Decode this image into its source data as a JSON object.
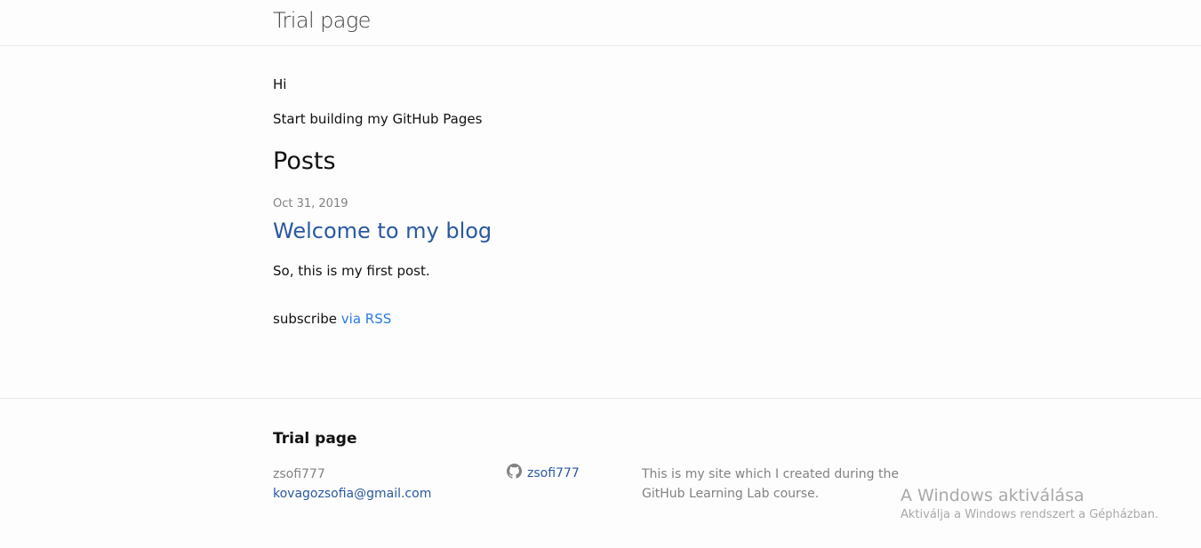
{
  "header": {
    "title": "Trial page"
  },
  "main": {
    "greeting": "Hi",
    "intro": "Start building my GitHub Pages",
    "posts_heading": "Posts",
    "posts": [
      {
        "date": "Oct 31, 2019",
        "title": "Welcome to my blog",
        "excerpt": "So, this is my first post."
      }
    ],
    "subscribe_text": "subscribe",
    "subscribe_link": "via RSS"
  },
  "footer": {
    "heading": "Trial page",
    "name": "zsofi777",
    "email": "kovagozsofia@gmail.com",
    "github_username": "zsofi777",
    "github_icon": "github-icon",
    "description": "This is my site which I created during the GitHub Learning Lab course."
  },
  "watermark": {
    "title": "A Windows aktiválása",
    "subtitle": "Aktiválja a Windows rendszert a Gépházban."
  },
  "colors": {
    "link": "#2a59a0",
    "muted": "#828282",
    "text": "#111111",
    "border": "#e8e8e8"
  }
}
